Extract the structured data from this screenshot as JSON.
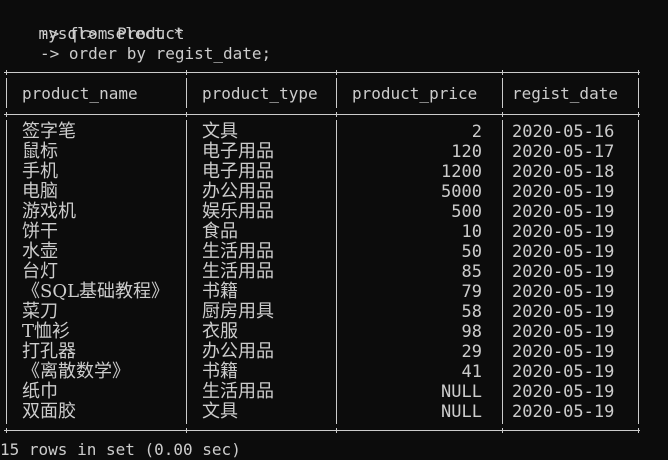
{
  "terminal": {
    "prompt": "mysql>",
    "command_lines": [
      "select *",
      "-> from Product",
      "-> order by regist_date;"
    ]
  },
  "table": {
    "columns": [
      "product_name",
      "product_type",
      "product_price",
      "regist_date"
    ],
    "rows": [
      [
        "签字笔",
        "文具",
        "2",
        "2020-05-16"
      ],
      [
        "鼠标",
        "电子用品",
        "120",
        "2020-05-17"
      ],
      [
        "手机",
        "电子用品",
        "1200",
        "2020-05-18"
      ],
      [
        "电脑",
        "办公用品",
        "5000",
        "2020-05-19"
      ],
      [
        "游戏机",
        "娱乐用品",
        "500",
        "2020-05-19"
      ],
      [
        "饼干",
        "食品",
        "10",
        "2020-05-19"
      ],
      [
        "水壶",
        "生活用品",
        "50",
        "2020-05-19"
      ],
      [
        "台灯",
        "生活用品",
        "85",
        "2020-05-19"
      ],
      [
        "《SQL基础教程》",
        "书籍",
        "79",
        "2020-05-19"
      ],
      [
        "菜刀",
        "厨房用具",
        "58",
        "2020-05-19"
      ],
      [
        "T恤衫",
        "衣服",
        "98",
        "2020-05-19"
      ],
      [
        "打孔器",
        "办公用品",
        "29",
        "2020-05-19"
      ],
      [
        "《离散数学》",
        "书籍",
        "41",
        "2020-05-19"
      ],
      [
        "纸巾",
        "生活用品",
        "NULL",
        "2020-05-19"
      ],
      [
        "双面胶",
        "文具",
        "NULL",
        "2020-05-19"
      ]
    ]
  },
  "footer": "15 rows in set (0.00 sec)"
}
